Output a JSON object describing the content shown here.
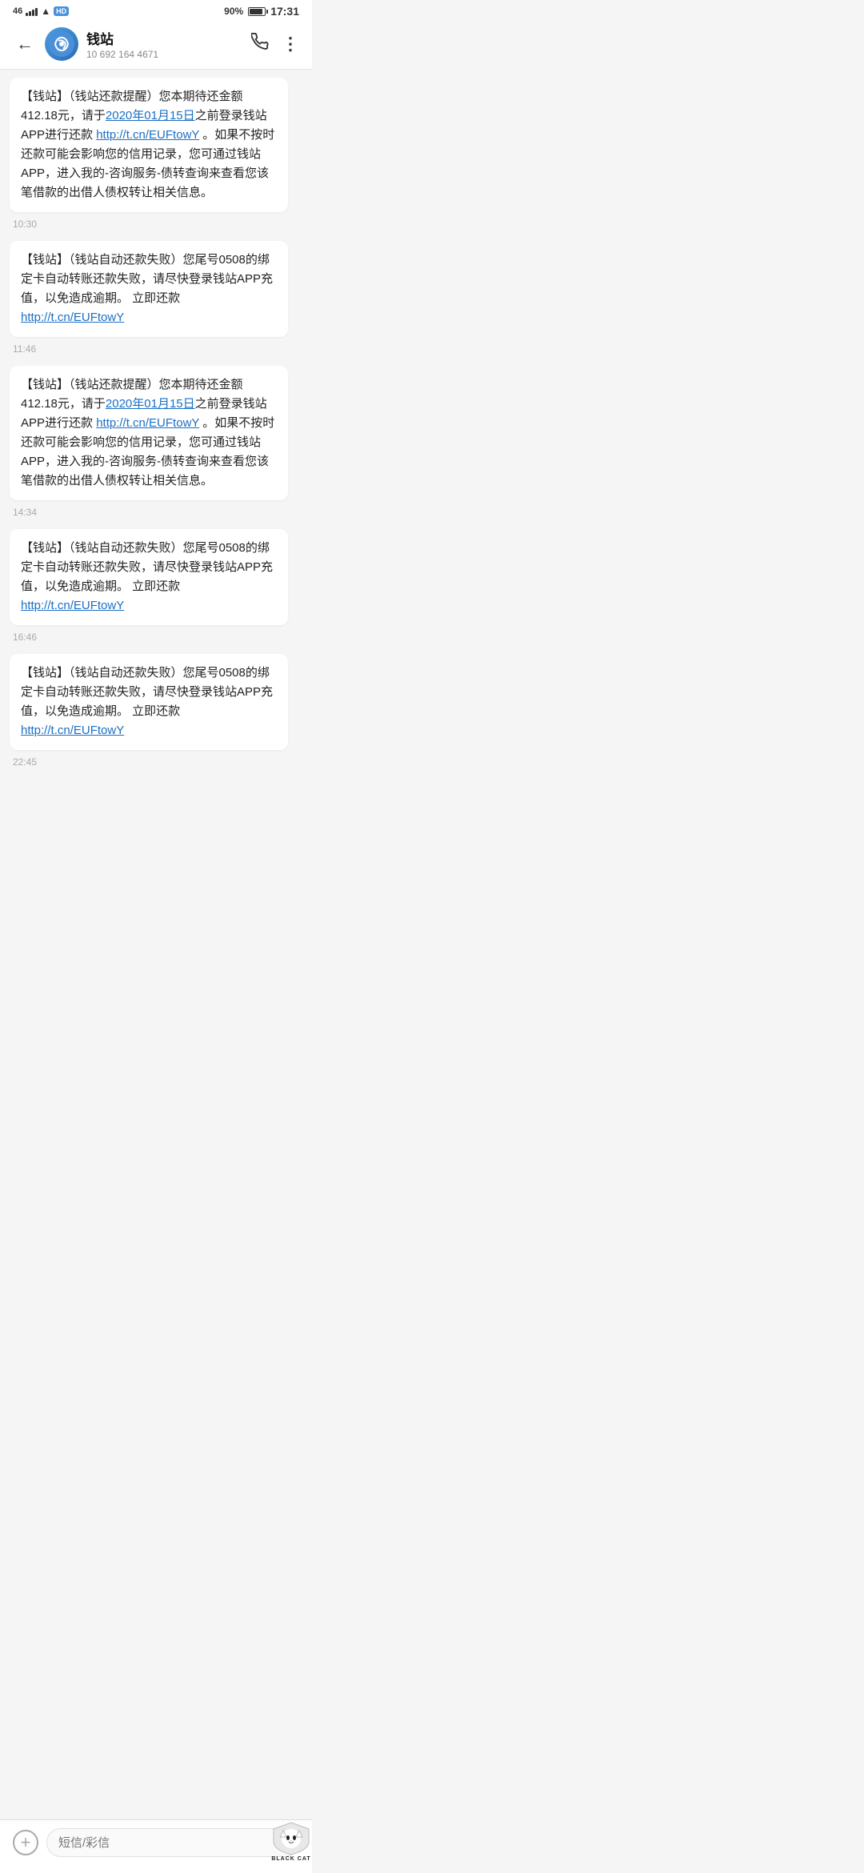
{
  "statusBar": {
    "network": "46",
    "battery": "90%",
    "time": "17:31"
  },
  "header": {
    "backLabel": "←",
    "contactName": "钱站",
    "contactNumber": "10 692 164 4671",
    "callIconLabel": "📞",
    "moreIconLabel": "⋮"
  },
  "messages": [
    {
      "id": 1,
      "text": "【钱站】（钱站还款提醒）您本期待还金额412.18元，请于",
      "dateLink": "2020年01月15日",
      "textMid": "之前登录钱站APP进行还款 ",
      "link": "http://t.cn/EUFtowY",
      "textEnd": " 。如果不按时还款可能会影响您的信用记录，您可通过钱站APP，进入我的-咨询服务-债转查询来查看您该笔借款的出借人债权转让相关信息。",
      "time": "10:30"
    },
    {
      "id": 2,
      "text": "【钱站】（钱站自动还款失败）您尾号0508的绑定卡自动转账还款失败，请尽快登录钱站APP充值，以免造成逾期。  立即还款 ",
      "link": "http://t.cn/EUFtowY",
      "textEnd": "",
      "time": "11:46"
    },
    {
      "id": 3,
      "text": "【钱站】（钱站还款提醒）您本期待还金额412.18元，请于",
      "dateLink": "2020年01月15日",
      "textMid": "之前登录钱站APP进行还款 ",
      "link": "http://t.cn/EUFtowY",
      "textEnd": " 。如果不按时还款可能会影响您的信用记录，您可通过钱站APP，进入我的-咨询服务-债转查询来查看您该笔借款的出借人债权转让相关信息。",
      "time": "14:34"
    },
    {
      "id": 4,
      "text": "【钱站】（钱站自动还款失败）您尾号0508的绑定卡自动转账还款失败，请尽快登录钱站APP充值，以免造成逾期。  立即还款 ",
      "link": "http://t.cn/EUFtowY",
      "textEnd": "",
      "time": "16:46"
    },
    {
      "id": 5,
      "text": "【钱站】（钱站自动还款失败）您尾号0508的绑定卡自动转账还款失败，请尽快登录钱站APP充值，以免造成逾期。  立即还款 ",
      "link": "http://t.cn/EUFtowY",
      "textEnd": "",
      "time": "22:45"
    }
  ],
  "inputBar": {
    "placeholder": "短信/彩信",
    "plusLabel": "+"
  },
  "watermark": {
    "text": "BLACK CAT"
  }
}
